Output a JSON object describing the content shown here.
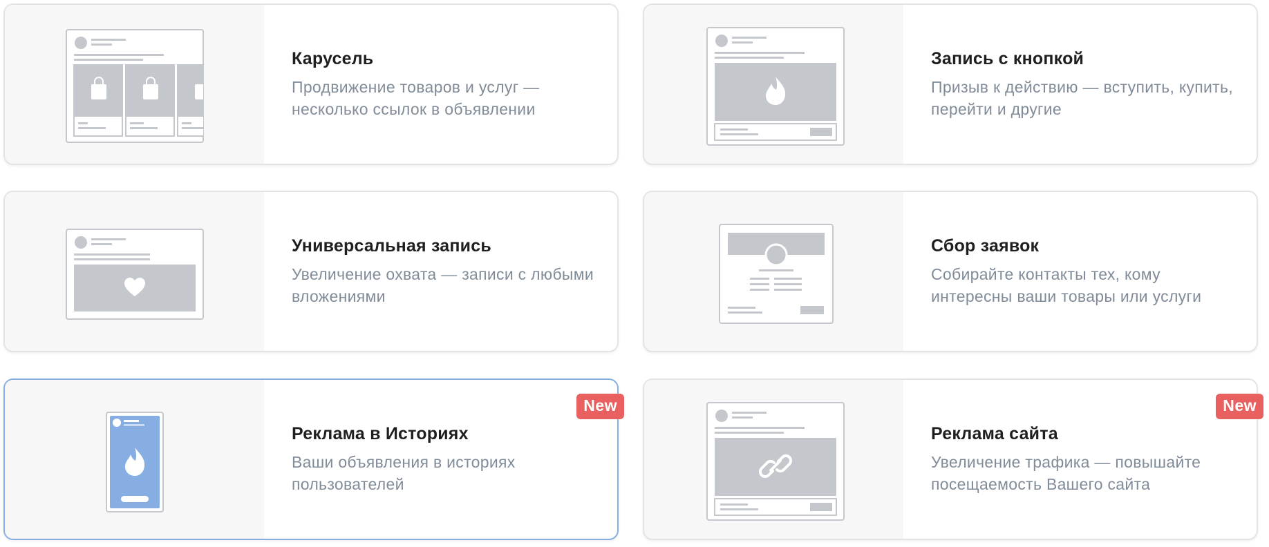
{
  "colors": {
    "placeholder": "#c4c7cc",
    "accent_blue": "#86aee3",
    "badge_red": "#e8605f",
    "title": "#1f1f21",
    "description": "#818c99"
  },
  "cards": [
    {
      "title": "Карусель",
      "description": "Продвижение товаров и услуг — несколько ссылок в объявлении",
      "icon": "shopping-bag-icon"
    },
    {
      "title": "Запись с кнопкой",
      "description": "Призыв к действию — вступить, купить, перейти и другие",
      "icon": "fire-icon"
    },
    {
      "title": "Универсальная запись",
      "description": "Увеличение охвата — записи с любыми вложениями",
      "icon": "heart-icon"
    },
    {
      "title": "Сбор заявок",
      "description": "Собирайте контакты тех, кому интересны ваши товары или услуги",
      "icon": "form-icon"
    },
    {
      "title": "Реклама в Историях",
      "description": "Ваши объявления в историях пользователей",
      "badge": "New",
      "selected": true,
      "icon": "fire-icon"
    },
    {
      "title": "Реклама сайта",
      "description": "Увеличение трафика — повышайте посещаемость Вашего сайта",
      "badge": "New",
      "icon": "link-icon"
    }
  ]
}
